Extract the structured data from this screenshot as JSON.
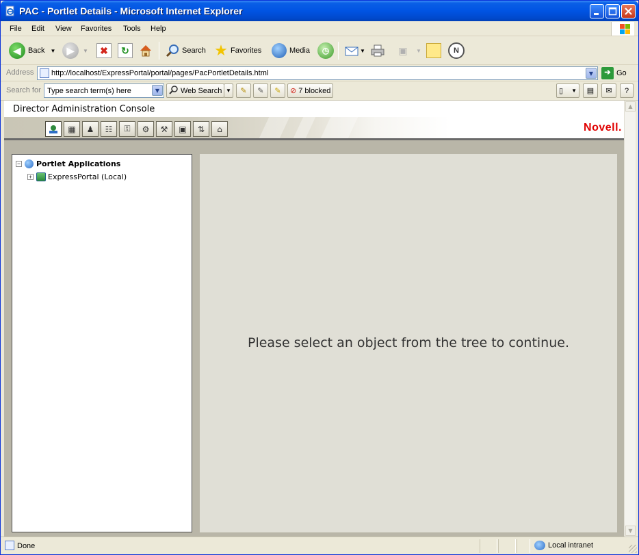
{
  "window": {
    "title": "PAC - Portlet Details - Microsoft Internet Explorer"
  },
  "menu": {
    "items": [
      "File",
      "Edit",
      "View",
      "Favorites",
      "Tools",
      "Help"
    ]
  },
  "toolbar": {
    "back_label": "Back",
    "search_label": "Search",
    "favorites_label": "Favorites",
    "media_label": "Media"
  },
  "address": {
    "label": "Address",
    "url": "http://localhost/ExpressPortal/portal/pages/PacPortletDetails.html",
    "go_label": "Go"
  },
  "search_bar": {
    "label": "Search for",
    "placeholder": "Type search term(s) here",
    "web_search_label": "Web Search",
    "blocked_label": "7 blocked"
  },
  "console": {
    "title": "Director Administration Console",
    "brand": "Novell.",
    "nav_icons": [
      "portlet-applications-icon",
      "layout-icon",
      "users-icon",
      "settings-icon",
      "keys-icon",
      "components-icon",
      "tools-icon",
      "frame-icon",
      "sync-icon",
      "home-icon"
    ]
  },
  "tree": {
    "root_label": "Portlet Applications",
    "children": [
      {
        "label": "ExpressPortal (Local)"
      }
    ]
  },
  "detail": {
    "message": "Please select an object from the tree to continue."
  },
  "status": {
    "text": "Done",
    "zone": "Local intranet"
  },
  "colors": {
    "title_bar": "#0054e3",
    "brand_red": "#e00000",
    "chrome": "#ece9d8",
    "panel_bg": "#b9b6a8",
    "detail_bg": "#e0dfd6"
  }
}
